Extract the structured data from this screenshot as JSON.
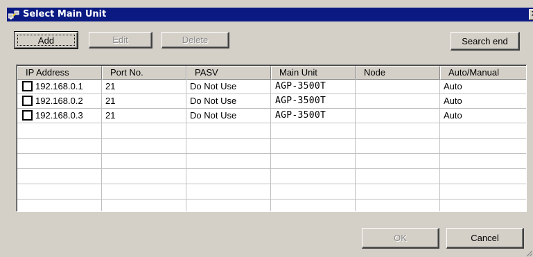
{
  "window": {
    "title": "Select Main Unit",
    "close_glyph": "✕",
    "icon": "network-app-icon"
  },
  "toolbar": {
    "add_label": "Add",
    "edit_label": "Edit",
    "delete_label": "Delete",
    "search_end_label": "Search end"
  },
  "table": {
    "columns": [
      "IP Address",
      "Port No.",
      "PASV",
      "Main Unit",
      "Node",
      "Auto/Manual"
    ],
    "rows": [
      {
        "checked": false,
        "ip": "192.168.0.1",
        "port": "21",
        "pasv": "Do Not Use",
        "main_unit": "AGP-3500T",
        "node": "",
        "auto_manual": "Auto"
      },
      {
        "checked": false,
        "ip": "192.168.0.2",
        "port": "21",
        "pasv": "Do Not Use",
        "main_unit": "AGP-3500T",
        "node": "",
        "auto_manual": "Auto"
      },
      {
        "checked": false,
        "ip": "192.168.0.3",
        "port": "21",
        "pasv": "Do Not Use",
        "main_unit": "AGP-3500T",
        "node": "",
        "auto_manual": "Auto"
      }
    ]
  },
  "footer": {
    "ok_label": "OK",
    "cancel_label": "Cancel"
  },
  "colors": {
    "titlebar": "#0a1a82",
    "dialog_bg": "#d4d0c8",
    "disabled_text": "#8c8c8c"
  }
}
